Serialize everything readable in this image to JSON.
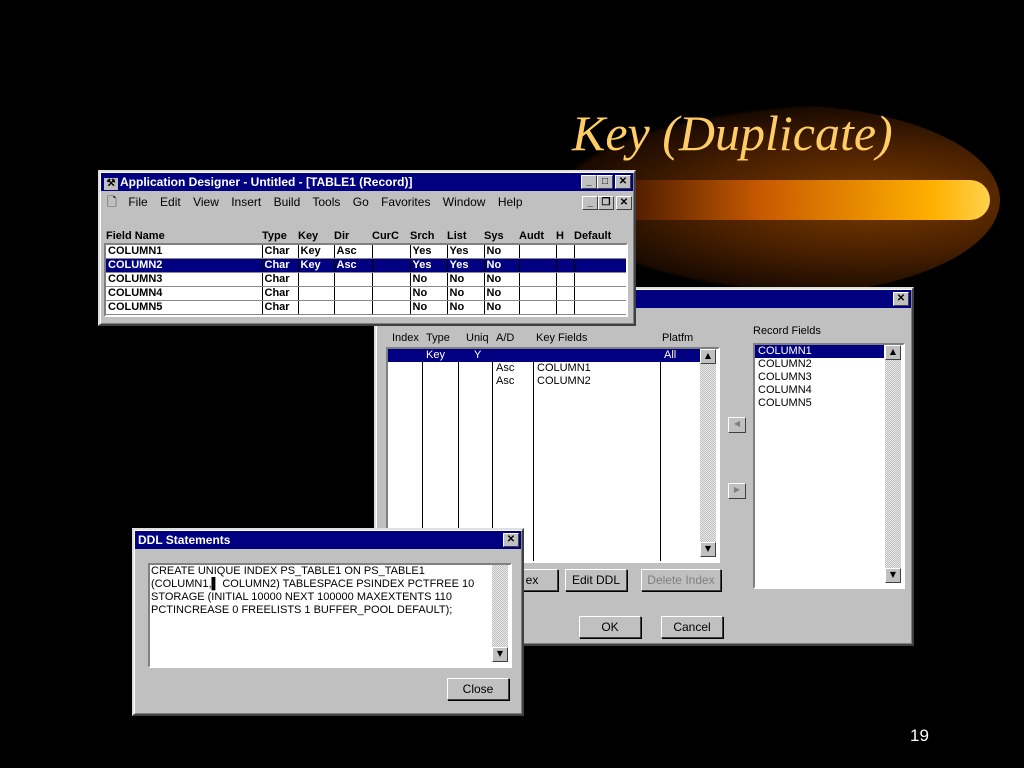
{
  "slide": {
    "title": "Key (Duplicate)",
    "page_number": "19"
  },
  "app_window": {
    "title": "Application Designer - Untitled - [TABLE1 (Record)]",
    "menus": [
      "File",
      "Edit",
      "View",
      "Insert",
      "Build",
      "Tools",
      "Go",
      "Favorites",
      "Window",
      "Help"
    ],
    "columns": [
      "Field Name",
      "Type",
      "Key",
      "Dir",
      "CurC",
      "Srch",
      "List",
      "Sys",
      "Audt",
      "H",
      "Default"
    ],
    "rows": [
      [
        "COLUMN1",
        "Char",
        "Key",
        "Asc",
        "",
        "Yes",
        "Yes",
        "No",
        "",
        "",
        ""
      ],
      [
        "COLUMN2",
        "Char",
        "Key",
        "Asc",
        "",
        "Yes",
        "Yes",
        "No",
        "",
        "",
        ""
      ],
      [
        "COLUMN3",
        "Char",
        "",
        "",
        "",
        "No",
        "No",
        "No",
        "",
        "",
        ""
      ],
      [
        "COLUMN4",
        "Char",
        "",
        "",
        "",
        "No",
        "No",
        "No",
        "",
        "",
        ""
      ],
      [
        "COLUMN5",
        "Char",
        "",
        "",
        "",
        "No",
        "No",
        "No",
        "",
        "",
        ""
      ]
    ],
    "selected_row": 1
  },
  "index_dialog": {
    "index_columns": [
      "Index",
      "Type",
      "Uniq",
      "A/D",
      "Key Fields",
      "Platfm"
    ],
    "index_rows": [
      [
        "",
        "Key",
        "Y",
        "",
        "",
        "All"
      ],
      [
        "",
        "",
        "",
        "Asc",
        "COLUMN1",
        ""
      ],
      [
        "",
        "",
        "",
        "Asc",
        "COLUMN2",
        ""
      ]
    ],
    "record_fields_label": "Record Fields",
    "record_fields": [
      "COLUMN1",
      "COLUMN2",
      "COLUMN3",
      "COLUMN4",
      "COLUMN5"
    ],
    "add_index_partial": "ex",
    "edit_ddl": "Edit DDL",
    "delete_index": "Delete Index",
    "ok": "OK",
    "cancel": "Cancel"
  },
  "ddl_dialog": {
    "title": "DDL Statements",
    "lines": [
      "CREATE UNIQUE INDEX PS_TABLE1 ON PS_TABLE1",
      "(COLUMN1,▌  COLUMN2) TABLESPACE PSINDEX PCTFREE 10",
      "STORAGE (INITIAL 10000 NEXT 100000 MAXEXTENTS 110",
      "PCTINCREASE 0 FREELISTS 1 BUFFER_POOL DEFAULT);"
    ],
    "close": "Close"
  },
  "icons": {
    "close": "✕",
    "minimize": "_",
    "maximize": "□",
    "restore": "❐",
    "up": "▲",
    "down": "▼",
    "left": "◀",
    "right": "▶"
  }
}
